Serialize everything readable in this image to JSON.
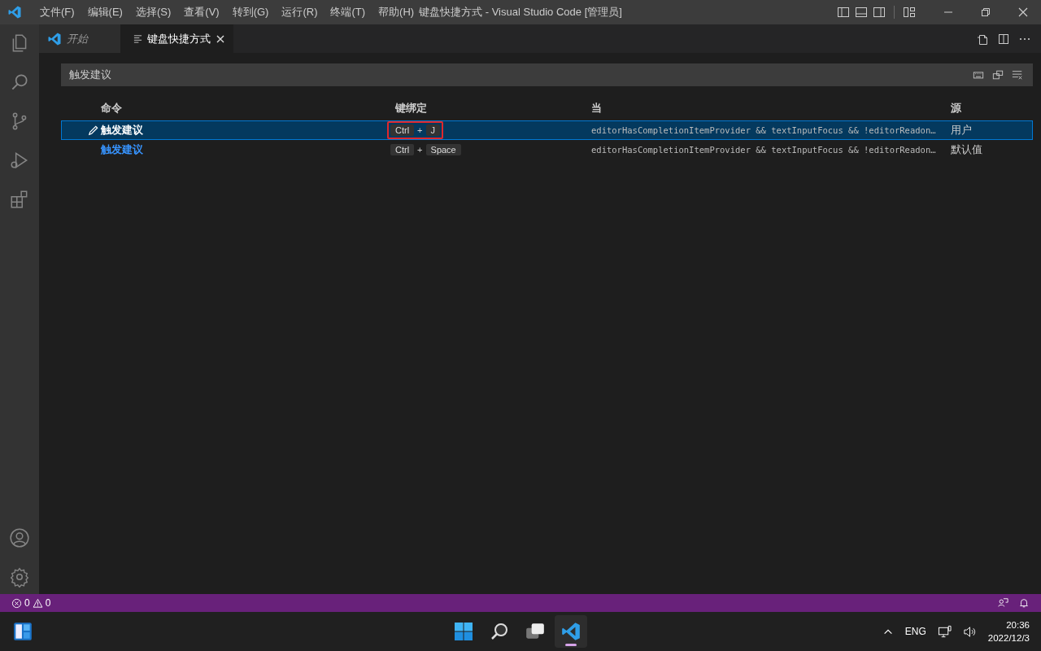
{
  "menu": [
    "文件(F)",
    "编辑(E)",
    "选择(S)",
    "查看(V)",
    "转到(G)",
    "运行(R)",
    "终端(T)",
    "帮助(H)"
  ],
  "window": {
    "title": "键盘快捷方式 - Visual Studio Code [管理员]"
  },
  "activity_bar": [
    {
      "kind": "files",
      "selected": false
    },
    {
      "kind": "search",
      "selected": false
    },
    {
      "kind": "scm",
      "selected": false
    },
    {
      "kind": "debug",
      "selected": false
    },
    {
      "kind": "extensions",
      "selected": false
    }
  ],
  "tabs": [
    {
      "label": "开始",
      "kind": "welcome",
      "selected": false
    },
    {
      "label": "键盘快捷方式",
      "kind": "settings",
      "selected": true
    }
  ],
  "search": {
    "value": "触发建议"
  },
  "table": {
    "columns": [
      "命令",
      "键绑定",
      "当",
      "源"
    ],
    "rows": [
      {
        "selected": true,
        "command": "触发建议",
        "keys": [
          {
            "kind": "key",
            "text": "Ctrl"
          },
          {
            "kind": "sep",
            "text": "+"
          },
          {
            "kind": "key",
            "text": "J"
          }
        ],
        "outlined": true,
        "when": "editorHasCompletionItemProvider && textInputFocus && !editorReadon…",
        "source": "用户"
      },
      {
        "selected": false,
        "command": "触发建议",
        "keys": [
          {
            "kind": "key",
            "text": "Ctrl"
          },
          {
            "kind": "sep",
            "text": "+"
          },
          {
            "kind": "key",
            "text": "Space"
          }
        ],
        "outlined": false,
        "when": "editorHasCompletionItemProvider && textInputFocus && !editorReadon…",
        "source": "默认值"
      }
    ]
  },
  "status_bar": {
    "errors": "0",
    "warnings": "0"
  },
  "taskbar": {
    "language": "ENG",
    "time": "20:36",
    "date": "2022/12/3"
  }
}
